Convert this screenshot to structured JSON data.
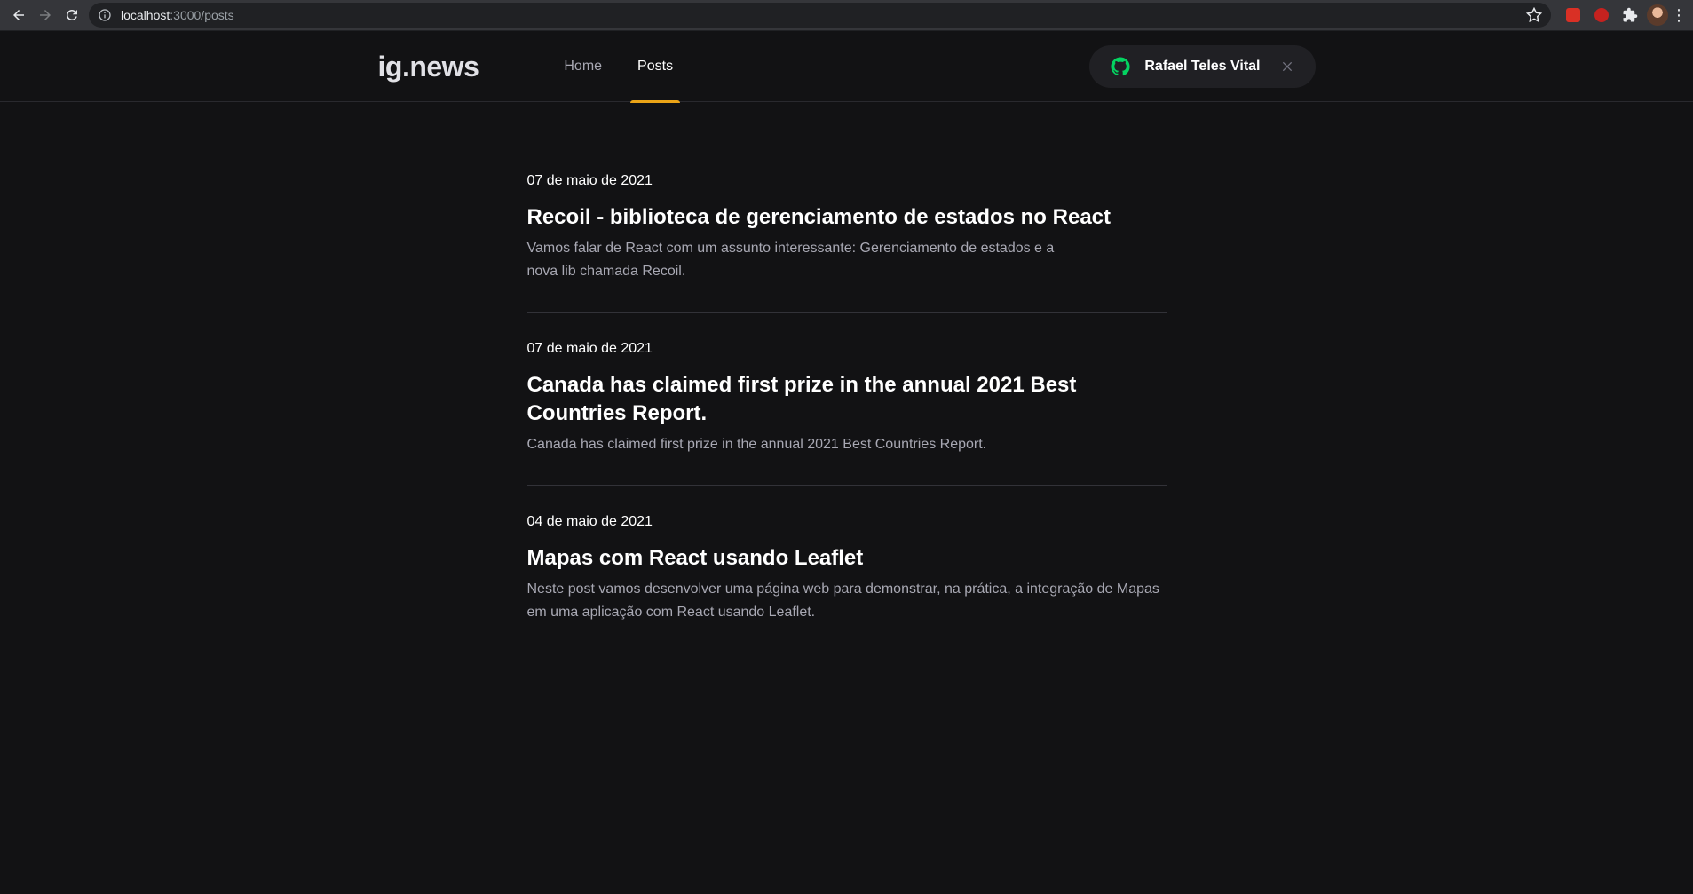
{
  "browser": {
    "url_host": "localhost",
    "url_path": ":3000/posts"
  },
  "header": {
    "logo": "ig.news",
    "nav": [
      {
        "label": "Home",
        "active": false
      },
      {
        "label": "Posts",
        "active": true
      }
    ],
    "user_name": "Rafael Teles Vital"
  },
  "posts": [
    {
      "date": "07 de maio de 2021",
      "title": "Recoil - biblioteca de gerenciamento de estados no React",
      "excerpt": "Vamos falar de React com um assunto interessante: Gerenciamento de estados e a nova lib chamada Recoil."
    },
    {
      "date": "07 de maio de 2021",
      "title": "Canada has claimed first prize in the annual 2021 Best Countries Report.",
      "excerpt": "Canada has claimed first prize in the annual 2021 Best Countries Report."
    },
    {
      "date": "04 de maio de 2021",
      "title": "Mapas com React usando Leaflet",
      "excerpt": "Neste post vamos desenvolver uma página web para demonstrar, na prática, a integração de Mapas em uma aplicação com React usando Leaflet."
    }
  ],
  "colors": {
    "background": "#121214",
    "accent": "#eba417",
    "github": "#04d361"
  }
}
